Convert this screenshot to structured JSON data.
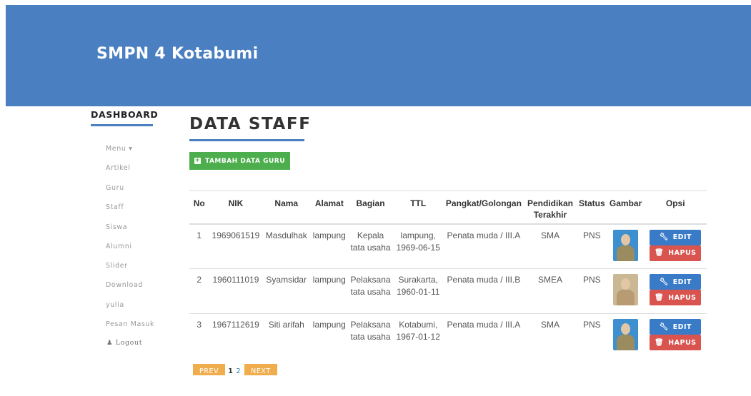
{
  "site": {
    "title": "SMPN 4 Kotabumi"
  },
  "sidebar": {
    "heading": "DASHBOARD",
    "items": [
      {
        "label": "Menu ▾"
      },
      {
        "label": "Artikel"
      },
      {
        "label": "Guru"
      },
      {
        "label": "Staff"
      },
      {
        "label": "Siswa"
      },
      {
        "label": "Alumni"
      },
      {
        "label": "Slider"
      },
      {
        "label": "Download"
      },
      {
        "label": "yulia"
      },
      {
        "label": "Pesan Masuk"
      },
      {
        "label": "Logout",
        "icon": "user-icon"
      }
    ]
  },
  "main": {
    "title": "DATA STAFF",
    "add_button": "TAMBAH DATA GURU",
    "table": {
      "headers": [
        "No",
        "NIK",
        "Nama",
        "Alamat",
        "Bagian",
        "TTL",
        "Pangkat/Golongan",
        "Pendidikan Terakhir",
        "Status",
        "Gambar",
        "Opsi"
      ],
      "rows": [
        {
          "no": "1",
          "nik": "1969061519",
          "nama": "Masdulhak",
          "alamat": "lampung",
          "bagian": "Kepala tata usaha",
          "ttl": "lampung, 1969-06-15",
          "pangkat": "Penata muda / III.A",
          "pendidikan": "SMA",
          "status": "PNS",
          "photo_bg": "blue"
        },
        {
          "no": "2",
          "nik": "1960111019",
          "nama": "Syamsidar",
          "alamat": "lampung",
          "bagian": "Pelaksana tata usaha",
          "ttl": "Surakarta, 1960-01-11",
          "pangkat": "Penata muda / III.B",
          "pendidikan": "SMEA",
          "status": "PNS",
          "photo_bg": "beige"
        },
        {
          "no": "3",
          "nik": "1967112619",
          "nama": "Siti arifah",
          "alamat": "lampung",
          "bagian": "Pelaksana tata usaha",
          "ttl": "Kotabumi, 1967-01-12",
          "pangkat": "Penata muda / III.A",
          "pendidikan": "SMA",
          "status": "PNS",
          "photo_bg": "blue"
        }
      ]
    },
    "row_buttons": {
      "edit": "EDIT",
      "delete": "HAPUS"
    },
    "pagination": {
      "prev": "PREV",
      "page1": "1",
      "page2": "2",
      "next": "NEXT"
    }
  },
  "colors": {
    "header": "#4a7fc1",
    "add": "#4cae4c",
    "edit": "#3a7bc8",
    "delete": "#d9534f",
    "pager": "#f0ad4e"
  }
}
